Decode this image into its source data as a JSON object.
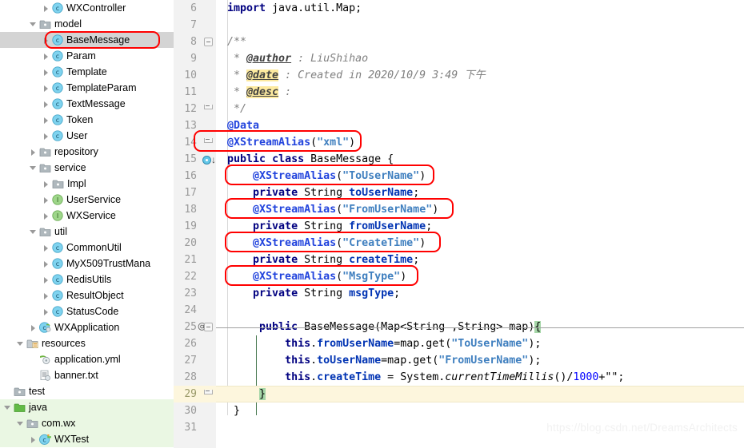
{
  "sidebar": {
    "rows": [
      {
        "indent": 3,
        "arrow": "right",
        "icon": "class-icon",
        "label": "WXController",
        "state": "normal"
      },
      {
        "indent": 2,
        "arrow": "down",
        "icon": "folder-icon",
        "label": "model",
        "state": "normal"
      },
      {
        "indent": 3,
        "arrow": "right",
        "icon": "class-icon",
        "label": "BaseMessage",
        "state": "selected"
      },
      {
        "indent": 3,
        "arrow": "right",
        "icon": "class-icon",
        "label": "Param",
        "state": "normal"
      },
      {
        "indent": 3,
        "arrow": "right",
        "icon": "class-icon",
        "label": "Template",
        "state": "normal"
      },
      {
        "indent": 3,
        "arrow": "right",
        "icon": "class-icon",
        "label": "TemplateParam",
        "state": "normal"
      },
      {
        "indent": 3,
        "arrow": "right",
        "icon": "class-icon",
        "label": "TextMessage",
        "state": "normal"
      },
      {
        "indent": 3,
        "arrow": "right",
        "icon": "class-icon",
        "label": "Token",
        "state": "normal"
      },
      {
        "indent": 3,
        "arrow": "right",
        "icon": "class-icon",
        "label": "User",
        "state": "normal"
      },
      {
        "indent": 2,
        "arrow": "right",
        "icon": "folder-icon",
        "label": "repository",
        "state": "normal"
      },
      {
        "indent": 2,
        "arrow": "down",
        "icon": "folder-icon",
        "label": "service",
        "state": "normal"
      },
      {
        "indent": 3,
        "arrow": "right",
        "icon": "folder-icon",
        "label": "Impl",
        "state": "normal"
      },
      {
        "indent": 3,
        "arrow": "right",
        "icon": "interface-icon",
        "label": "UserService",
        "state": "normal"
      },
      {
        "indent": 3,
        "arrow": "right",
        "icon": "interface-icon",
        "label": "WXService",
        "state": "normal"
      },
      {
        "indent": 2,
        "arrow": "down",
        "icon": "folder-icon",
        "label": "util",
        "state": "normal"
      },
      {
        "indent": 3,
        "arrow": "right",
        "icon": "class-icon",
        "label": "CommonUtil",
        "state": "normal"
      },
      {
        "indent": 3,
        "arrow": "right",
        "icon": "class-icon",
        "label": "MyX509TrustMana",
        "state": "normal"
      },
      {
        "indent": 3,
        "arrow": "right",
        "icon": "class-icon",
        "label": "RedisUtils",
        "state": "normal"
      },
      {
        "indent": 3,
        "arrow": "right",
        "icon": "class-icon",
        "label": "ResultObject",
        "state": "normal"
      },
      {
        "indent": 3,
        "arrow": "right",
        "icon": "class-icon",
        "label": "StatusCode",
        "state": "normal"
      },
      {
        "indent": 2,
        "arrow": "right",
        "icon": "spring-class-icon",
        "label": "WXApplication",
        "state": "normal"
      },
      {
        "indent": 1,
        "arrow": "down",
        "icon": "resources-folder-icon",
        "label": "resources",
        "state": "normal"
      },
      {
        "indent": 2,
        "arrow": "none",
        "icon": "yml-file-icon",
        "label": "application.yml",
        "state": "normal"
      },
      {
        "indent": 2,
        "arrow": "none",
        "icon": "txt-file-icon",
        "label": "banner.txt",
        "state": "normal"
      },
      {
        "indent": 0,
        "arrow": "none",
        "icon": "folder-icon",
        "label": "test",
        "state": "normal"
      },
      {
        "indent": 0,
        "arrow": "down",
        "icon": "test-source-folder-icon",
        "label": "java",
        "state": "srcroot"
      },
      {
        "indent": 1,
        "arrow": "down",
        "icon": "package-icon",
        "label": "com.wx",
        "state": "srcroot"
      },
      {
        "indent": 2,
        "arrow": "right",
        "icon": "test-class-icon",
        "label": "WXTest",
        "state": "srcroot"
      }
    ],
    "selected_highlight_color": "#ff0000"
  },
  "editor": {
    "gutter": {
      "first_line": 6,
      "last_line": 31,
      "highlighted_line": 29,
      "line_numbers": [
        6,
        7,
        8,
        9,
        10,
        11,
        12,
        13,
        14,
        15,
        16,
        17,
        18,
        19,
        20,
        21,
        22,
        23,
        24,
        25,
        26,
        27,
        28,
        29,
        30,
        31
      ],
      "at_marker_line": 25,
      "at_marker_label": "@"
    },
    "lines": {
      "l6_import_kw": "import",
      "l6_import_pkg": " java.util.Map;",
      "l8_doc_open": "/**",
      "l9_star": " * ",
      "l9_tag": "@author",
      "l9_text": " : LiuShihao",
      "l10_star": " * ",
      "l10_tag": "@date",
      "l10_text": " : Created in 2020/10/9 3:49 下午",
      "l11_star": " * ",
      "l11_tag": "@desc",
      "l11_text": " : ",
      "l12_doc_close": " */",
      "l13_data_ann": "@Data",
      "l14_ann": "@XStreamAlias",
      "l14_open": "(",
      "l14_arg": "\"xml\"",
      "l14_close": ")",
      "l15_public": "public",
      "l15_class": "class",
      "l15_name": " BaseMessage ",
      "l15_brace": "{",
      "l16_ann": "@XStreamAlias",
      "l16_arg": "\"ToUserName\"",
      "l17_kw": "private",
      "l17_type": " String ",
      "l17_field": "toUserName",
      "l17_semi": ";",
      "l18_ann": "@XStreamAlias",
      "l18_arg": "\"FromUserName\"",
      "l19_kw": "private",
      "l19_type": " String ",
      "l19_field": "fromUserName",
      "l19_semi": ";",
      "l20_ann": "@XStreamAlias",
      "l20_arg": "\"CreateTime\"",
      "l21_kw": "private",
      "l21_type": " String ",
      "l21_field": "createTime",
      "l21_semi": ";",
      "l22_ann": "@XStreamAlias",
      "l22_arg": "\"MsgType\"",
      "l23_kw": "private",
      "l23_type": " String ",
      "l23_field": "msgType",
      "l23_semi": ";",
      "l25_public": "public",
      "l25_ctor": " BaseMessage(Map<String ,String> map)",
      "l25_brace": "{",
      "l26_this": "this",
      "l26_dot": ".",
      "l26_field": "fromUserName",
      "l26_mid": "=map.get(",
      "l26_arg": "\"ToUserName\"",
      "l26_end": ");",
      "l27_this": "this",
      "l27_dot": ".",
      "l27_field": "toUserName",
      "l27_mid": "=map.get(",
      "l27_arg": "\"FromUserName\"",
      "l27_end": ");",
      "l28_this": "this",
      "l28_dot": ".",
      "l28_field": "createTime",
      "l28_mid": " = System.",
      "l28_call": "currentTimeMillis",
      "l28_parens": "()/",
      "l28_num": "1000",
      "l28_tail": "+\"\";",
      "l29_brace": "}",
      "l30_brace": "}"
    },
    "annotation_boxes": [
      {
        "target": "l14-xstreamalias-xml"
      },
      {
        "target": "l16-xstreamalias-tousername"
      },
      {
        "target": "l18-xstreamalias-fromusername"
      },
      {
        "target": "l20-xstreamalias-createtime"
      },
      {
        "target": "l22-xstreamalias-msgtype"
      }
    ]
  },
  "watermark": {
    "text": "https://blog.csdn.net/DreamsArchitects"
  },
  "colors": {
    "annotation": "#2244dd",
    "string": "#3f7fbf",
    "keyword": "#000080",
    "field": "#0033b3",
    "comment": "#808080",
    "highlight_box": "#ff0000",
    "selected_row": "#d4d4d4",
    "source_root": "#eaf7e3",
    "current_line": "#fdf6dd"
  }
}
